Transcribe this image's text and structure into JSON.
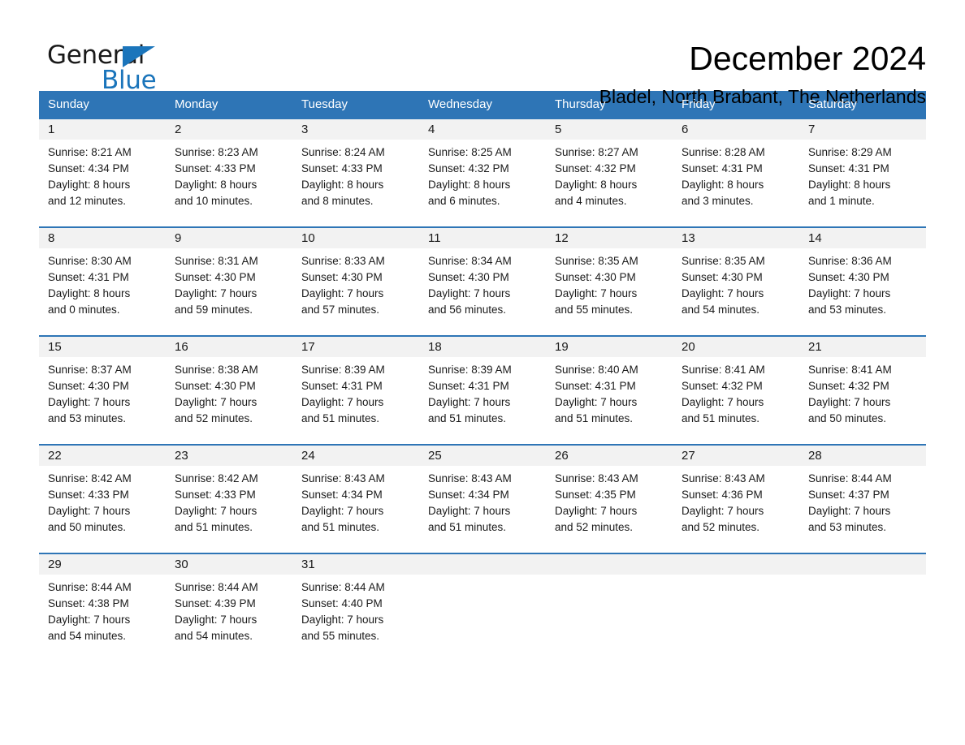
{
  "brand": {
    "name_part1": "General",
    "name_part2": "Blue",
    "accent_color": "#1b75bb"
  },
  "header": {
    "title": "December 2024",
    "subtitle": "Bladel, North Brabant, The Netherlands"
  },
  "theme": {
    "header_blue": "#2e75b6",
    "daynum_band": "#f2f2f2",
    "text": "#1a1a1a"
  },
  "weekday_headers": [
    "Sunday",
    "Monday",
    "Tuesday",
    "Wednesday",
    "Thursday",
    "Friday",
    "Saturday"
  ],
  "weeks": [
    [
      {
        "day": "1",
        "sunrise": "Sunrise: 8:21 AM",
        "sunset": "Sunset: 4:34 PM",
        "daylight_line1": "Daylight: 8 hours",
        "daylight_line2": "and 12 minutes."
      },
      {
        "day": "2",
        "sunrise": "Sunrise: 8:23 AM",
        "sunset": "Sunset: 4:33 PM",
        "daylight_line1": "Daylight: 8 hours",
        "daylight_line2": "and 10 minutes."
      },
      {
        "day": "3",
        "sunrise": "Sunrise: 8:24 AM",
        "sunset": "Sunset: 4:33 PM",
        "daylight_line1": "Daylight: 8 hours",
        "daylight_line2": "and 8 minutes."
      },
      {
        "day": "4",
        "sunrise": "Sunrise: 8:25 AM",
        "sunset": "Sunset: 4:32 PM",
        "daylight_line1": "Daylight: 8 hours",
        "daylight_line2": "and 6 minutes."
      },
      {
        "day": "5",
        "sunrise": "Sunrise: 8:27 AM",
        "sunset": "Sunset: 4:32 PM",
        "daylight_line1": "Daylight: 8 hours",
        "daylight_line2": "and 4 minutes."
      },
      {
        "day": "6",
        "sunrise": "Sunrise: 8:28 AM",
        "sunset": "Sunset: 4:31 PM",
        "daylight_line1": "Daylight: 8 hours",
        "daylight_line2": "and 3 minutes."
      },
      {
        "day": "7",
        "sunrise": "Sunrise: 8:29 AM",
        "sunset": "Sunset: 4:31 PM",
        "daylight_line1": "Daylight: 8 hours",
        "daylight_line2": "and 1 minute."
      }
    ],
    [
      {
        "day": "8",
        "sunrise": "Sunrise: 8:30 AM",
        "sunset": "Sunset: 4:31 PM",
        "daylight_line1": "Daylight: 8 hours",
        "daylight_line2": "and 0 minutes."
      },
      {
        "day": "9",
        "sunrise": "Sunrise: 8:31 AM",
        "sunset": "Sunset: 4:30 PM",
        "daylight_line1": "Daylight: 7 hours",
        "daylight_line2": "and 59 minutes."
      },
      {
        "day": "10",
        "sunrise": "Sunrise: 8:33 AM",
        "sunset": "Sunset: 4:30 PM",
        "daylight_line1": "Daylight: 7 hours",
        "daylight_line2": "and 57 minutes."
      },
      {
        "day": "11",
        "sunrise": "Sunrise: 8:34 AM",
        "sunset": "Sunset: 4:30 PM",
        "daylight_line1": "Daylight: 7 hours",
        "daylight_line2": "and 56 minutes."
      },
      {
        "day": "12",
        "sunrise": "Sunrise: 8:35 AM",
        "sunset": "Sunset: 4:30 PM",
        "daylight_line1": "Daylight: 7 hours",
        "daylight_line2": "and 55 minutes."
      },
      {
        "day": "13",
        "sunrise": "Sunrise: 8:35 AM",
        "sunset": "Sunset: 4:30 PM",
        "daylight_line1": "Daylight: 7 hours",
        "daylight_line2": "and 54 minutes."
      },
      {
        "day": "14",
        "sunrise": "Sunrise: 8:36 AM",
        "sunset": "Sunset: 4:30 PM",
        "daylight_line1": "Daylight: 7 hours",
        "daylight_line2": "and 53 minutes."
      }
    ],
    [
      {
        "day": "15",
        "sunrise": "Sunrise: 8:37 AM",
        "sunset": "Sunset: 4:30 PM",
        "daylight_line1": "Daylight: 7 hours",
        "daylight_line2": "and 53 minutes."
      },
      {
        "day": "16",
        "sunrise": "Sunrise: 8:38 AM",
        "sunset": "Sunset: 4:30 PM",
        "daylight_line1": "Daylight: 7 hours",
        "daylight_line2": "and 52 minutes."
      },
      {
        "day": "17",
        "sunrise": "Sunrise: 8:39 AM",
        "sunset": "Sunset: 4:31 PM",
        "daylight_line1": "Daylight: 7 hours",
        "daylight_line2": "and 51 minutes."
      },
      {
        "day": "18",
        "sunrise": "Sunrise: 8:39 AM",
        "sunset": "Sunset: 4:31 PM",
        "daylight_line1": "Daylight: 7 hours",
        "daylight_line2": "and 51 minutes."
      },
      {
        "day": "19",
        "sunrise": "Sunrise: 8:40 AM",
        "sunset": "Sunset: 4:31 PM",
        "daylight_line1": "Daylight: 7 hours",
        "daylight_line2": "and 51 minutes."
      },
      {
        "day": "20",
        "sunrise": "Sunrise: 8:41 AM",
        "sunset": "Sunset: 4:32 PM",
        "daylight_line1": "Daylight: 7 hours",
        "daylight_line2": "and 51 minutes."
      },
      {
        "day": "21",
        "sunrise": "Sunrise: 8:41 AM",
        "sunset": "Sunset: 4:32 PM",
        "daylight_line1": "Daylight: 7 hours",
        "daylight_line2": "and 50 minutes."
      }
    ],
    [
      {
        "day": "22",
        "sunrise": "Sunrise: 8:42 AM",
        "sunset": "Sunset: 4:33 PM",
        "daylight_line1": "Daylight: 7 hours",
        "daylight_line2": "and 50 minutes."
      },
      {
        "day": "23",
        "sunrise": "Sunrise: 8:42 AM",
        "sunset": "Sunset: 4:33 PM",
        "daylight_line1": "Daylight: 7 hours",
        "daylight_line2": "and 51 minutes."
      },
      {
        "day": "24",
        "sunrise": "Sunrise: 8:43 AM",
        "sunset": "Sunset: 4:34 PM",
        "daylight_line1": "Daylight: 7 hours",
        "daylight_line2": "and 51 minutes."
      },
      {
        "day": "25",
        "sunrise": "Sunrise: 8:43 AM",
        "sunset": "Sunset: 4:34 PM",
        "daylight_line1": "Daylight: 7 hours",
        "daylight_line2": "and 51 minutes."
      },
      {
        "day": "26",
        "sunrise": "Sunrise: 8:43 AM",
        "sunset": "Sunset: 4:35 PM",
        "daylight_line1": "Daylight: 7 hours",
        "daylight_line2": "and 52 minutes."
      },
      {
        "day": "27",
        "sunrise": "Sunrise: 8:43 AM",
        "sunset": "Sunset: 4:36 PM",
        "daylight_line1": "Daylight: 7 hours",
        "daylight_line2": "and 52 minutes."
      },
      {
        "day": "28",
        "sunrise": "Sunrise: 8:44 AM",
        "sunset": "Sunset: 4:37 PM",
        "daylight_line1": "Daylight: 7 hours",
        "daylight_line2": "and 53 minutes."
      }
    ],
    [
      {
        "day": "29",
        "sunrise": "Sunrise: 8:44 AM",
        "sunset": "Sunset: 4:38 PM",
        "daylight_line1": "Daylight: 7 hours",
        "daylight_line2": "and 54 minutes."
      },
      {
        "day": "30",
        "sunrise": "Sunrise: 8:44 AM",
        "sunset": "Sunset: 4:39 PM",
        "daylight_line1": "Daylight: 7 hours",
        "daylight_line2": "and 54 minutes."
      },
      {
        "day": "31",
        "sunrise": "Sunrise: 8:44 AM",
        "sunset": "Sunset: 4:40 PM",
        "daylight_line1": "Daylight: 7 hours",
        "daylight_line2": "and 55 minutes."
      },
      {
        "day": "",
        "sunrise": "",
        "sunset": "",
        "daylight_line1": "",
        "daylight_line2": ""
      },
      {
        "day": "",
        "sunrise": "",
        "sunset": "",
        "daylight_line1": "",
        "daylight_line2": ""
      },
      {
        "day": "",
        "sunrise": "",
        "sunset": "",
        "daylight_line1": "",
        "daylight_line2": ""
      },
      {
        "day": "",
        "sunrise": "",
        "sunset": "",
        "daylight_line1": "",
        "daylight_line2": ""
      }
    ]
  ]
}
